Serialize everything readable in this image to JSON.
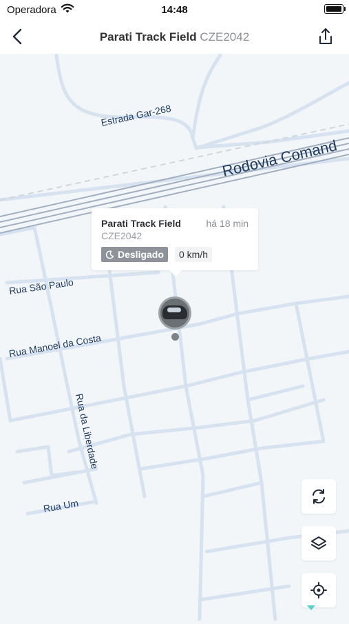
{
  "status_bar": {
    "carrier": "Operadora",
    "time": "14:48"
  },
  "header": {
    "title": "Parati Track Field",
    "plate": "CZE2042"
  },
  "map": {
    "labels": {
      "estrada": "Estrada Gar-268",
      "rodovia": "Rodovia Comand",
      "sao_paulo": "Rua São Paulo",
      "manoel": "Rua Manoel da Costa",
      "liberdade": "Rua da Liberdade",
      "um": "Rua Um"
    }
  },
  "popup": {
    "vehicle_name": "Parati Track Field",
    "time_ago": "há 18 min",
    "plate": "CZE2042",
    "status": "Desligado",
    "speed": "0 km/h"
  },
  "colors": {
    "road": "#d4e0ee",
    "highway": "#9aa6b9",
    "map_bg": "#f3f6f8",
    "label": "#1e3a5f"
  }
}
